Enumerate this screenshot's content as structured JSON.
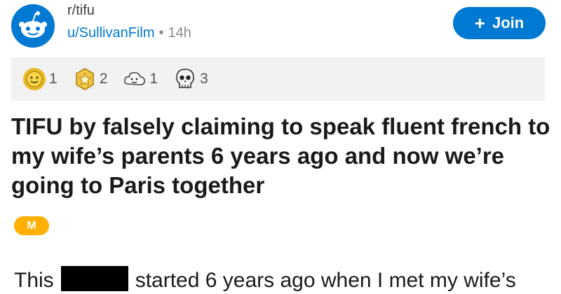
{
  "post": {
    "subreddit": "r/tifu",
    "author": "u/SullivanFilm",
    "separator": "•",
    "age": "14h",
    "join_label": "Join",
    "join_icon": "plus-icon",
    "awards": [
      {
        "icon": "sun-face-award-icon",
        "count": "1"
      },
      {
        "icon": "medal-award-icon",
        "count": "2"
      },
      {
        "icon": "cloud-face-award-icon",
        "count": "1"
      },
      {
        "icon": "skull-award-icon",
        "count": "3"
      }
    ],
    "title": "TIFU by falsely claiming to speak fluent french to my wife’s parents 6 years ago and now we’re going to Paris together",
    "flair": "M",
    "body_start": "This",
    "body_rest": "started 6 years ago when I met my wife’s"
  },
  "colors": {
    "accent": "#0079d3",
    "flair": "#ffb000",
    "awards_bar": "#f2f2f2"
  }
}
